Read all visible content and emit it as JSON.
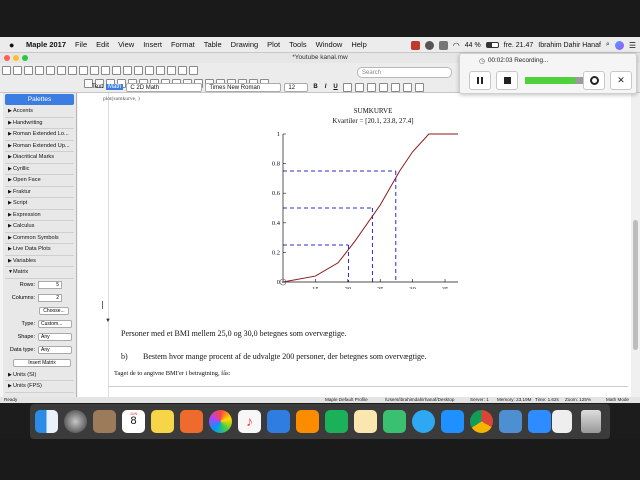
{
  "menubar": {
    "app_name": "Maple 2017",
    "items": [
      "File",
      "Edit",
      "View",
      "Insert",
      "Format",
      "Table",
      "Drawing",
      "Plot",
      "Tools",
      "Window",
      "Help"
    ],
    "battery": "44 %",
    "clock": "fre. 21.47",
    "user": "Ibrahim Dahir Hanaf"
  },
  "window": {
    "title": "*Youtube kanal.mw",
    "search_placeholder": "Search"
  },
  "format_bar": {
    "text_label": "Text",
    "math_label": "Math",
    "style": "C  2D Math",
    "font": "Times New Roman",
    "size": "12",
    "buttons": [
      "B",
      "I",
      "U"
    ]
  },
  "palettes": {
    "title": "Palettes",
    "items": [
      "Accents",
      "Handwriting",
      "Roman Extended Lo...",
      "Roman Extended Up...",
      "Diacritical Marks",
      "Cyrillic",
      "Open Face",
      "Fraktur",
      "Script",
      "Expression",
      "Calculus",
      "Common Symbols",
      "Live Data Plots",
      "Variables"
    ],
    "matrix": {
      "label": "Matrix",
      "rows_label": "Rows:",
      "rows_value": "5",
      "cols_label": "Columns:",
      "cols_value": "2",
      "choose_label": "Choose...",
      "type_label": "Type:",
      "type_value": "Custom...",
      "shape_label": "Shape:",
      "shape_value": "Any",
      "datatype_label": "Data type:",
      "datatype_value": "Any",
      "insert_label": "Insert Matrix"
    },
    "after_items": [
      "Units (SI)",
      "Units (FPS)"
    ]
  },
  "document": {
    "code_line": "plot(sumkurve, )",
    "paragraph1": "Personer med et BMI mellem 25,0 og 30,0 betegnes som overvægtige.",
    "question_label": "b)",
    "question_text": "Bestem hvor mange procent af de udvalgte 200 personer, der betegnes som overvægtige.",
    "paragraph2": "Taget de to angivne BMI'er i betragtning, fås:"
  },
  "chart_data": {
    "type": "line",
    "title": "SUMKURVE",
    "subtitle": "Kvartiler = [20.1, 23.8, 27.4]",
    "x": [
      10,
      15,
      18.5,
      21,
      25,
      28,
      30,
      32.5,
      35,
      37
    ],
    "y": [
      0,
      0.04,
      0.13,
      0.27,
      0.52,
      0.75,
      0.88,
      1.0,
      1.0,
      1.0
    ],
    "xlim": [
      10,
      37
    ],
    "ylim": [
      0,
      1
    ],
    "xticks": [
      15,
      20,
      25,
      30,
      35
    ],
    "yticks": [
      0,
      0.2,
      0.4,
      0.6,
      0.8,
      1
    ],
    "ytick_labels": [
      "0",
      "0.2",
      "0.4",
      "0.6",
      "0.8",
      "1"
    ],
    "quartiles": [
      {
        "x": 20.1,
        "y": 0.25
      },
      {
        "x": 23.8,
        "y": 0.5
      },
      {
        "x": 27.4,
        "y": 0.75
      }
    ],
    "line_color": "#8b1a1a",
    "dashed_color": "#2b2bd6"
  },
  "statusbar": {
    "ready": "Ready",
    "profile": "Maple Default Profile",
    "path": "/Users/ibrahimdahirhanaf/Desktop",
    "server": "Server: 1",
    "memory": "Memory: 23.19M",
    "time": "Time: 1.62s",
    "zoom": "Zoom: 125%",
    "mode": "Math Mode"
  },
  "recording": {
    "status": "00:02:03 Recording..."
  },
  "dock": {
    "calendar_month": "JUN",
    "calendar_day": "8"
  }
}
